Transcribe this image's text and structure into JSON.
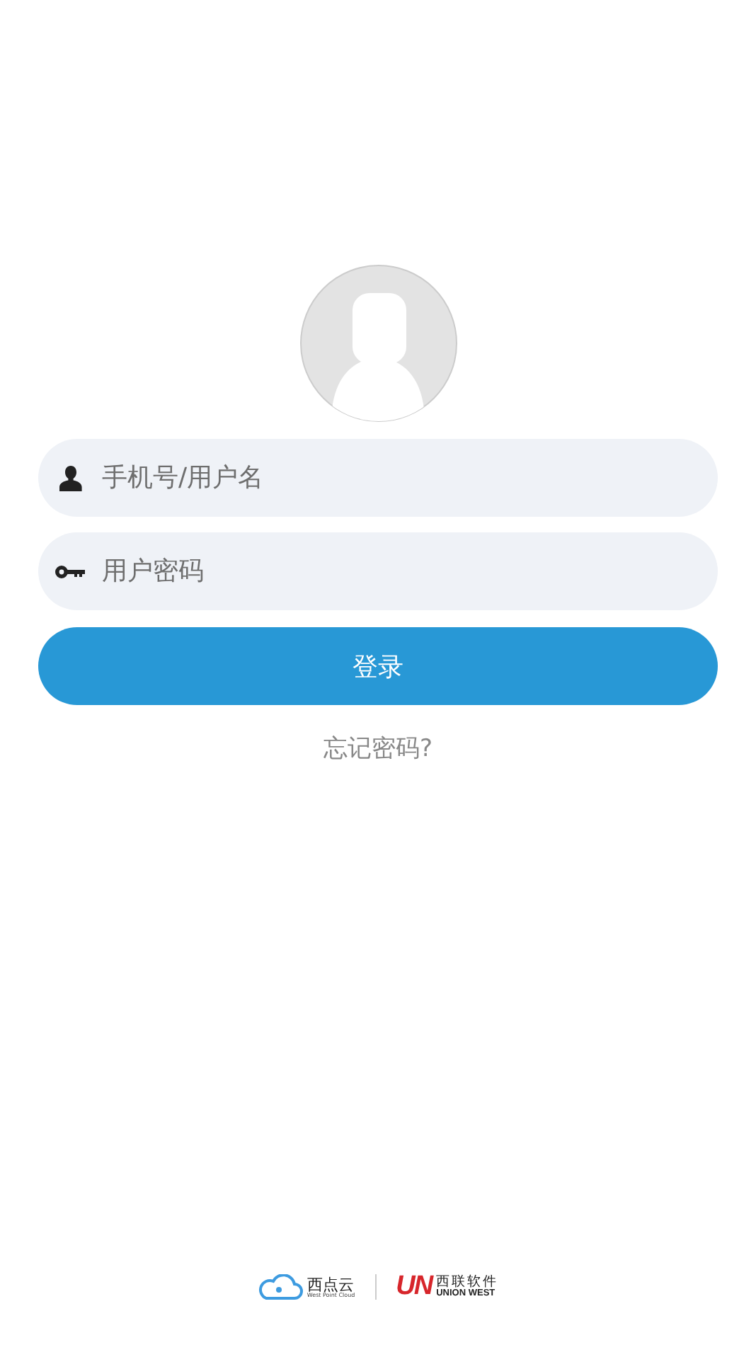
{
  "avatar": {
    "kind": "placeholder"
  },
  "fields": [
    {
      "kind": "user",
      "placeholder": "手机号/用户名"
    },
    {
      "kind": "key",
      "placeholder": "用户密码"
    }
  ],
  "login_button": {
    "label": "登录"
  },
  "forgot_link": {
    "label": "忘记密码?"
  },
  "footer": {
    "brand_1": {
      "name": "西点云",
      "subtitle": "West Point Cloud"
    },
    "brand_2": {
      "mark": "UN",
      "name": "西联软件",
      "subtitle": "UNION WEST"
    }
  }
}
